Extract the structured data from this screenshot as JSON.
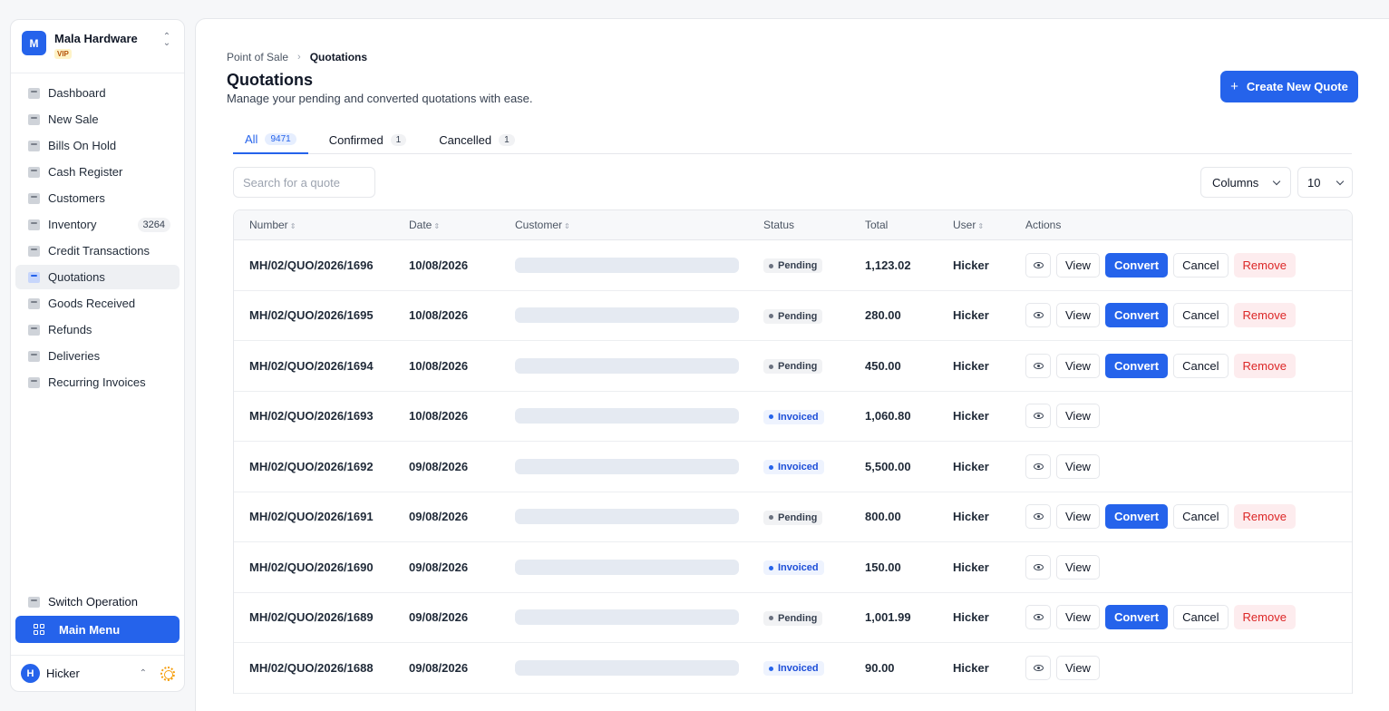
{
  "org": {
    "initial": "M",
    "name": "Mala Hardware",
    "badge": "VIP"
  },
  "nav": [
    {
      "label": "Dashboard",
      "icon": "dashboard-icon"
    },
    {
      "label": "New Sale",
      "icon": "tag-icon"
    },
    {
      "label": "Bills On Hold",
      "icon": "bill-icon"
    },
    {
      "label": "Cash Register",
      "icon": "register-icon"
    },
    {
      "label": "Customers",
      "icon": "customers-icon"
    },
    {
      "label": "Inventory",
      "icon": "box-icon",
      "count": "3264"
    },
    {
      "label": "Credit Transactions",
      "icon": "credit-icon"
    },
    {
      "label": "Quotations",
      "icon": "quote-icon",
      "active": true
    },
    {
      "label": "Goods Received",
      "icon": "download-icon"
    },
    {
      "label": "Refunds",
      "icon": "refund-icon"
    },
    {
      "label": "Deliveries",
      "icon": "delivery-icon"
    },
    {
      "label": "Recurring Invoices",
      "icon": "recurring-icon"
    }
  ],
  "switch_operation": "Switch Operation",
  "main_menu": "Main Menu",
  "user": {
    "initial": "H",
    "name": "Hicker"
  },
  "breadcrumb": {
    "parent": "Point of Sale",
    "current": "Quotations"
  },
  "page": {
    "title": "Quotations",
    "subtitle": "Manage your pending and converted quotations with ease."
  },
  "create_button": "Create New Quote",
  "tabs": [
    {
      "label": "All",
      "count": "9471",
      "active": true
    },
    {
      "label": "Confirmed",
      "count": "1"
    },
    {
      "label": "Cancelled",
      "count": "1"
    }
  ],
  "search": {
    "placeholder": "Search for a quote"
  },
  "columns_button": "Columns",
  "page_size": "10",
  "table": {
    "headers": {
      "number": "Number",
      "date": "Date",
      "customer": "Customer",
      "status": "Status",
      "total": "Total",
      "user": "User",
      "actions": "Actions"
    },
    "action_labels": {
      "view": "View",
      "convert": "Convert",
      "cancel": "Cancel",
      "remove": "Remove"
    },
    "rows": [
      {
        "number": "MH/02/QUO/2026/1696",
        "date": "10/08/2026",
        "status": "Pending",
        "total": "1,123.02",
        "user": "Hicker"
      },
      {
        "number": "MH/02/QUO/2026/1695",
        "date": "10/08/2026",
        "status": "Pending",
        "total": "280.00",
        "user": "Hicker"
      },
      {
        "number": "MH/02/QUO/2026/1694",
        "date": "10/08/2026",
        "status": "Pending",
        "total": "450.00",
        "user": "Hicker"
      },
      {
        "number": "MH/02/QUO/2026/1693",
        "date": "10/08/2026",
        "status": "Invoiced",
        "total": "1,060.80",
        "user": "Hicker"
      },
      {
        "number": "MH/02/QUO/2026/1692",
        "date": "09/08/2026",
        "status": "Invoiced",
        "total": "5,500.00",
        "user": "Hicker"
      },
      {
        "number": "MH/02/QUO/2026/1691",
        "date": "09/08/2026",
        "status": "Pending",
        "total": "800.00",
        "user": "Hicker"
      },
      {
        "number": "MH/02/QUO/2026/1690",
        "date": "09/08/2026",
        "status": "Invoiced",
        "total": "150.00",
        "user": "Hicker"
      },
      {
        "number": "MH/02/QUO/2026/1689",
        "date": "09/08/2026",
        "status": "Pending",
        "total": "1,001.99",
        "user": "Hicker"
      },
      {
        "number": "MH/02/QUO/2026/1688",
        "date": "09/08/2026",
        "status": "Invoiced",
        "total": "90.00",
        "user": "Hicker"
      }
    ]
  }
}
